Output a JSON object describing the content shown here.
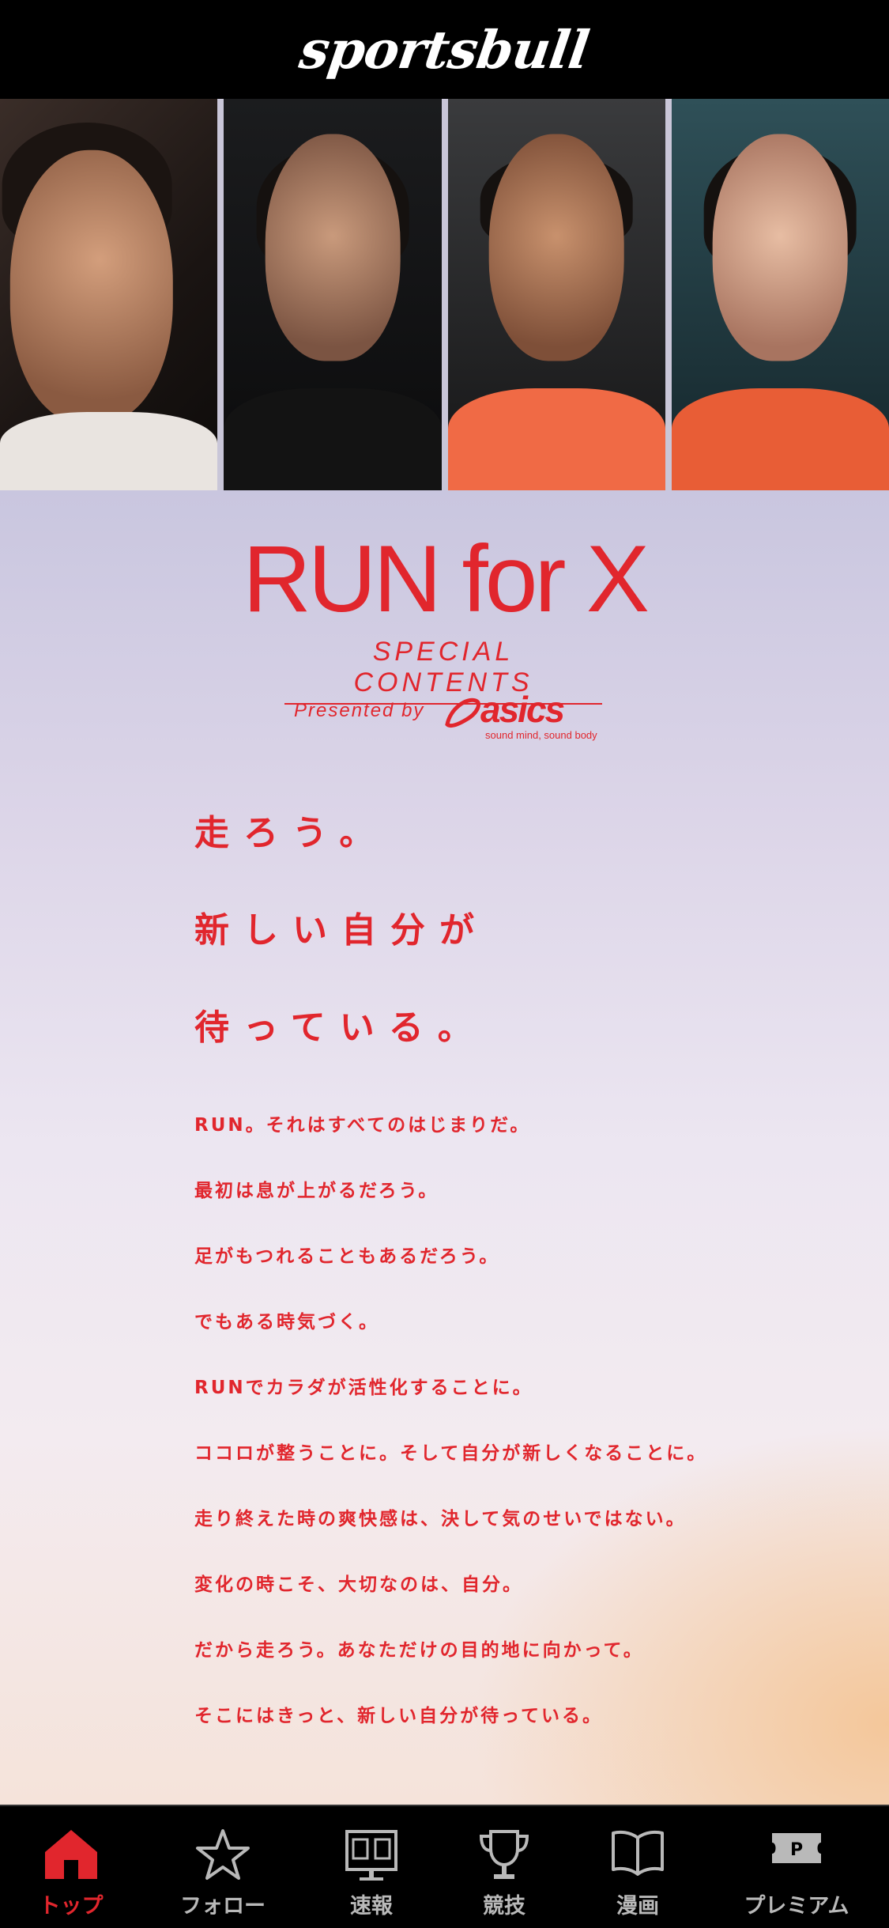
{
  "header": {
    "brand": "sportsbull"
  },
  "hero": {
    "title": "RUN for X",
    "subtitle": "SPECIAL CONTENTS",
    "presented_by": "Presented by",
    "sponsor": "asics",
    "sponsor_tagline": "sound mind, sound body"
  },
  "headline": [
    "走ろう。",
    "新しい自分が",
    "待っている。"
  ],
  "body": [
    "RUN。それはすべてのはじまりだ。",
    "最初は息が上がるだろう。",
    "足がもつれることもあるだろう。",
    "でもある時気づく。",
    "RUNでカラダが活性化することに。",
    "ココロが整うことに。そして自分が新しくなることに。",
    "走り終えた時の爽快感は、決して気のせいではない。",
    "変化の時こそ、大切なのは、自分。",
    "だから走ろう。あなただけの目的地に向かって。",
    "そこにはきっと、新しい自分が待っている。"
  ],
  "tabs": [
    {
      "label": "トップ",
      "icon": "home-icon",
      "active": true
    },
    {
      "label": "フォロー",
      "icon": "star-icon",
      "active": false
    },
    {
      "label": "速報",
      "icon": "scoreboard-icon",
      "active": false
    },
    {
      "label": "競技",
      "icon": "trophy-icon",
      "active": false
    },
    {
      "label": "漫画",
      "icon": "book-icon",
      "active": false
    },
    {
      "label": "プレミアム",
      "icon": "ticket-icon",
      "active": false
    }
  ],
  "colors": {
    "accent": "#e1262d",
    "tab_inactive": "#b9b9b9",
    "bar": "#000000"
  }
}
